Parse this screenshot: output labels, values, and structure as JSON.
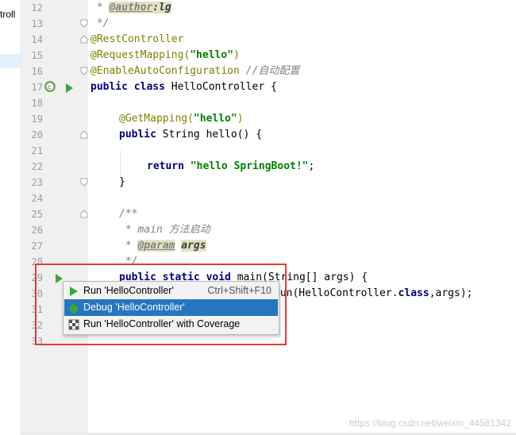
{
  "project_panel": {
    "visible_text": "troll"
  },
  "line_numbers": [
    "12",
    "13",
    "14",
    "15",
    "16",
    "17",
    "18",
    "19",
    "20",
    "21",
    "22",
    "23",
    "24",
    "25",
    "26",
    "27",
    "28",
    "29",
    "30",
    "31",
    "32",
    "33"
  ],
  "code": {
    "l12_prefix": " * ",
    "l12_tag": "@author",
    "l12_val": ":lg",
    "l13": " */",
    "l14": "@RestController",
    "l15_ann": "@RequestMapping(",
    "l15_str": "\"hello\"",
    "l15_end": ")",
    "l16_ann": "@EnableAutoConfiguration",
    "l16_cm": " //自动配置",
    "l17_kw": "public class",
    "l17_rest": " HelloController {",
    "l19_ann": "@GetMapping(",
    "l19_str": "\"hello\"",
    "l19_end": ")",
    "l20_kw": "public",
    "l20_rest": " String hello() {",
    "l22_kw": "return",
    "l22_str": " \"hello SpringBoot!\"",
    "l22_end": ";",
    "l23": "}",
    "l25": "/**",
    "l26": " * main 方法启动",
    "l27_prefix": " * ",
    "l27_tag": "@param",
    "l27_val": "args",
    "l28": " */",
    "l29_kw": "public static void",
    "l29_rest": " main(String[] args) {",
    "l30_a": "run(HelloController.",
    "l30_kw": "class",
    "l30_b": ",args);"
  },
  "popup": {
    "items": [
      {
        "label": "Run 'HelloController'",
        "shortcut": "Ctrl+Shift+F10",
        "icon": "run-icon"
      },
      {
        "label": "Debug 'HelloController'",
        "shortcut": "",
        "icon": "debug-icon"
      },
      {
        "label": "Run 'HelloController' with Coverage",
        "shortcut": "",
        "icon": "coverage-icon"
      }
    ],
    "selected_index": 1
  },
  "watermark": "https://blog.csdn.net/weixin_44581342",
  "colors": {
    "selection": "#2675bf",
    "highlight_box": "#e23a3a",
    "run_green": "#3aa63a"
  }
}
